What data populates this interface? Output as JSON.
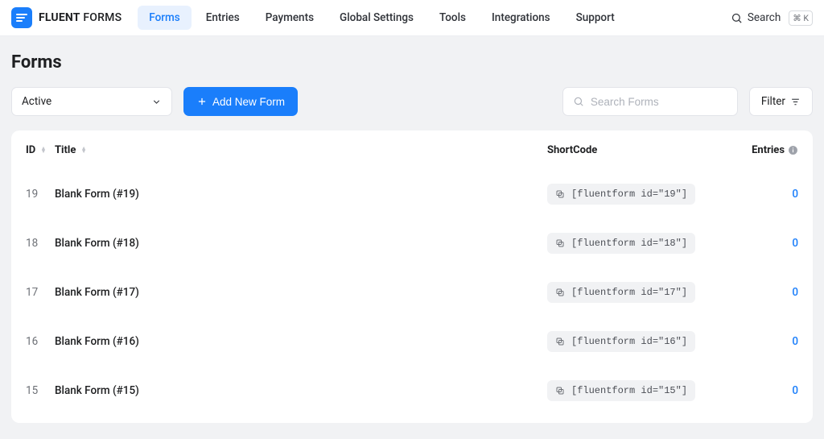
{
  "brand": {
    "bold": "FLUENT",
    "light": " FORMS"
  },
  "nav": {
    "items": [
      "Forms",
      "Entries",
      "Payments",
      "Global Settings",
      "Tools",
      "Integrations",
      "Support"
    ],
    "active_index": 0
  },
  "top_search": {
    "label": "Search",
    "shortcut": "⌘ K"
  },
  "page": {
    "title": "Forms"
  },
  "toolbar": {
    "status_select": "Active",
    "add_button": "Add New Form",
    "search_placeholder": "Search Forms",
    "filter_label": "Filter"
  },
  "table": {
    "headers": {
      "id": "ID",
      "title": "Title",
      "shortcode": "ShortCode",
      "entries": "Entries"
    },
    "rows": [
      {
        "id": "19",
        "title": "Blank Form (#19)",
        "shortcode": "[fluentform id=\"19\"]",
        "entries": "0"
      },
      {
        "id": "18",
        "title": "Blank Form (#18)",
        "shortcode": "[fluentform id=\"18\"]",
        "entries": "0"
      },
      {
        "id": "17",
        "title": "Blank Form (#17)",
        "shortcode": "[fluentform id=\"17\"]",
        "entries": "0"
      },
      {
        "id": "16",
        "title": "Blank Form (#16)",
        "shortcode": "[fluentform id=\"16\"]",
        "entries": "0"
      },
      {
        "id": "15",
        "title": "Blank Form (#15)",
        "shortcode": "[fluentform id=\"15\"]",
        "entries": "0"
      }
    ]
  }
}
